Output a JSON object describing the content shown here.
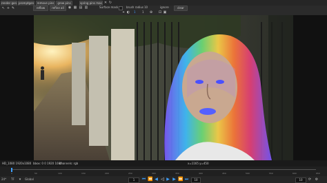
{
  "toolbar_top": {
    "buttons": [
      "render gen",
      "promptgen",
      "remove pins",
      "grow pins",
      "spring pins mask"
    ],
    "row2_buttons": [
      "reflow",
      "refine all"
    ],
    "surface_mask_label": "Surface mask",
    "brush_radius_label": "brush radius",
    "brush_radius_value": "10",
    "clear_label": "clear",
    "ignore_label": "ignore",
    "opacity_value": "1",
    "zoom_value": "1"
  },
  "info_bar": {
    "format": "HD_1080 1920x1080",
    "bbox": "bbox: 0 0 1920 1080",
    "channels": "channels: rgb",
    "cursor": "x=1165 y=450"
  },
  "timeline": {
    "ticks": [
      "1",
      "50",
      "100",
      "150",
      "200",
      "250",
      "300",
      "350",
      "400",
      "450",
      "500",
      "550",
      "600",
      "650"
    ],
    "current_frame": "1"
  },
  "controls": {
    "fps_label": "24*",
    "mode": "TF",
    "global_label": "Global",
    "frame_field": "1",
    "skip_field": "10",
    "end_field": "10"
  },
  "colors": {
    "accent": "#3ea0ff"
  }
}
